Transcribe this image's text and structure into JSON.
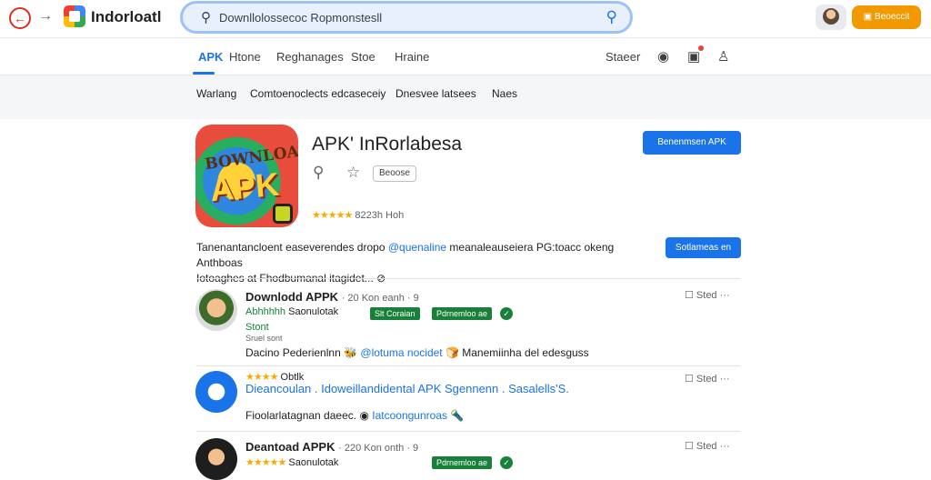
{
  "topbar": {
    "brand": "Indorloatl",
    "search_value": "Downllolossecoc Ropmonstesll",
    "signin_label": "Beoeccit"
  },
  "tabs": {
    "items": [
      "APK",
      "Htone",
      "Reghanages",
      "Stoe",
      "Hraine"
    ],
    "right_label": "Staeer"
  },
  "subnav": {
    "items": [
      "Warlang",
      "Comtoenoclects edcaseceiy",
      "Dnesvee latsees",
      "Naes"
    ]
  },
  "app": {
    "icon_top_text": "BOWNLOAD",
    "icon_main_text": "APK",
    "title": "APK' InRorlabesa",
    "chip": "Beoose",
    "rating": "8223h Hoh",
    "install_button": "Benenmsen APK",
    "secondary_button": "Sotlameas en",
    "description_line1_a": "Tanenantancloent easeverendes dropo",
    "description_line1_link": "@quenaline",
    "description_line1_b": "meanaleauseiera PG:toacc okeng Anthboas",
    "description_line2": "Iotoaghes at Fhodbumanal itagidet..."
  },
  "reviews": [
    {
      "name": "Downlodd APPK",
      "meta": "· 20 Kon eanh · 9",
      "stars_text": "Abhhhhh",
      "label": "Saonulotak",
      "chip1": "Slt Coraian",
      "chip2": "Pdrnemloo ae",
      "sub": "Stont",
      "sub_small": "Sruel sont",
      "body_a": "Dacino Pederienlnn",
      "body_link": "@lotuma nocidet",
      "body_b": "Manemiinha del edesguss",
      "right": "Sted"
    },
    {
      "name": "Dieancoulan . Idoweillandidental APK Sgennenn . Sasalells'S.",
      "meta": "Obtlk",
      "body_a": "Fioolarlatagnan daeec.",
      "body_link": "Iatcoongunroas",
      "right": "Sted"
    },
    {
      "name": "Deantoad APPK",
      "meta": "· 220 Kon onth · 9",
      "label": "Saonulotak",
      "chip2": "Pdrnemloo ae",
      "right": "Sted"
    }
  ]
}
